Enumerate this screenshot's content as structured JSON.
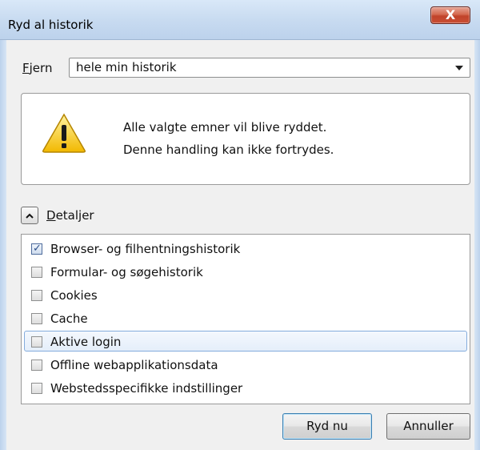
{
  "window": {
    "title": "Ryd al historik",
    "close_label": "X"
  },
  "range": {
    "label_first": "F",
    "label_rest": "jern",
    "selected": "hele min historik"
  },
  "warning": {
    "line1": "Alle valgte emner vil blive ryddet.",
    "line2": "Denne handling kan ikke fortrydes.",
    "icon": "warning-triangle-icon"
  },
  "details": {
    "label_first": "D",
    "label_rest": "etaljer",
    "expanded": true
  },
  "items": [
    {
      "label": "Browser- og filhentningshistorik",
      "checked": true
    },
    {
      "label": "Formular- og søgehistorik",
      "checked": false
    },
    {
      "label": "Cookies",
      "checked": false
    },
    {
      "label": "Cache",
      "checked": false
    },
    {
      "label": "Aktive login",
      "checked": false,
      "highlighted": true
    },
    {
      "label": "Offline webapplikationsdata",
      "checked": false
    },
    {
      "label": "Webstedsspecifikke indstillinger",
      "checked": false
    }
  ],
  "buttons": {
    "clear": "Ryd nu",
    "cancel": "Annuller"
  },
  "colors": {
    "warning_yellow": "#f4c400",
    "accent_blue": "#84acdd"
  }
}
